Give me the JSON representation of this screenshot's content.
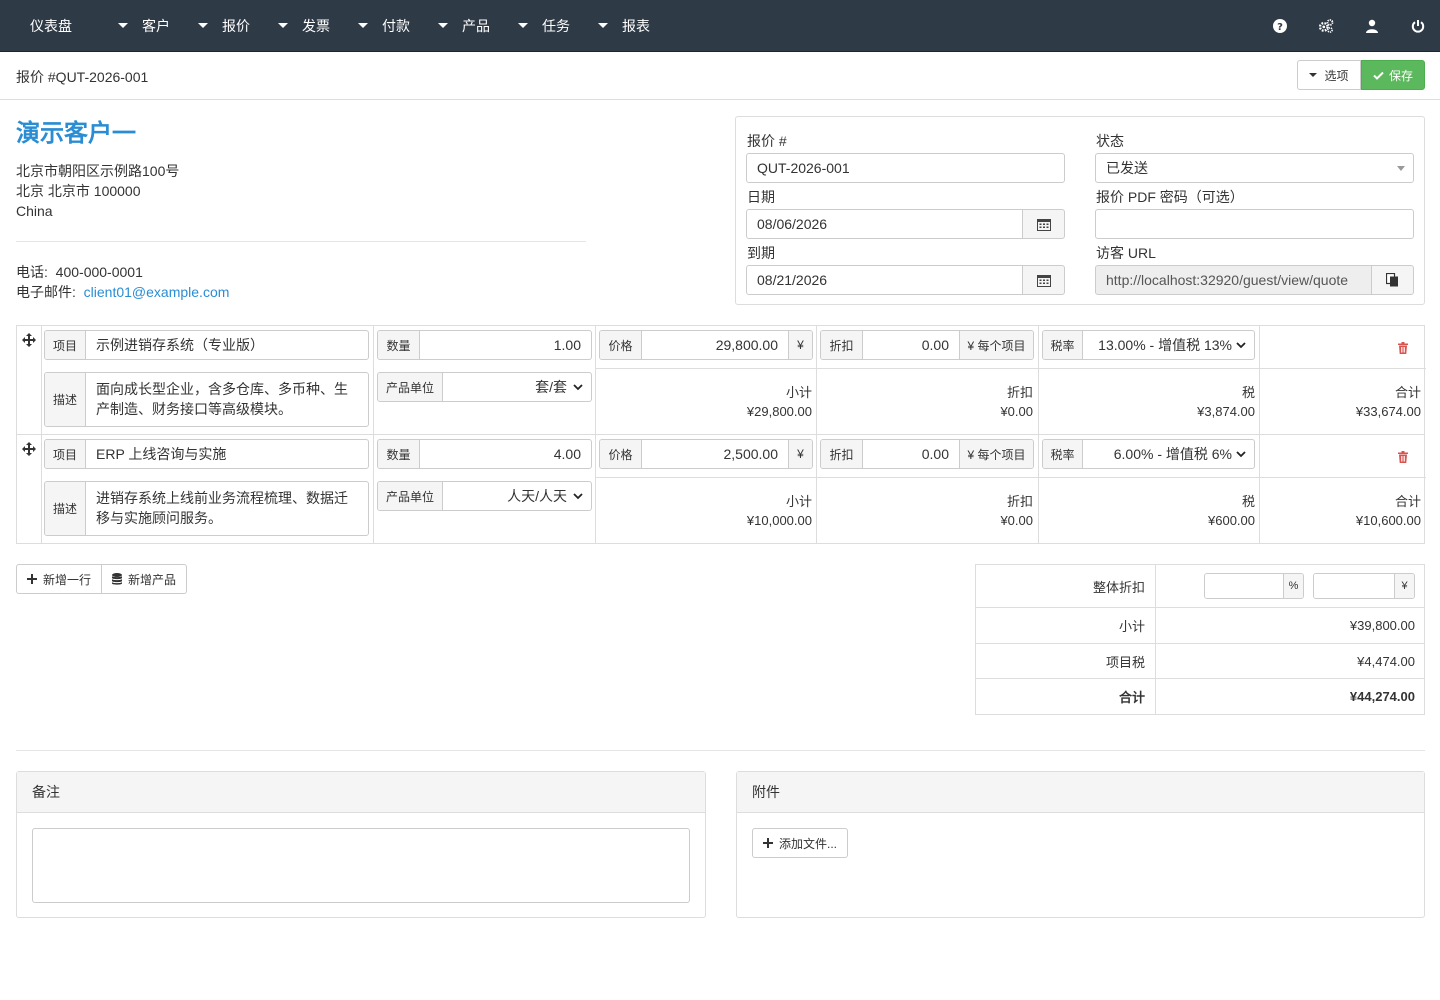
{
  "nav": {
    "items": [
      {
        "label": "仪表盘"
      },
      {
        "label": "客户"
      },
      {
        "label": "报价"
      },
      {
        "label": "发票"
      },
      {
        "label": "付款"
      },
      {
        "label": "产品"
      },
      {
        "label": "任务"
      },
      {
        "label": "报表"
      }
    ],
    "right_icons": [
      "question-icon",
      "gears-icon",
      "user-icon",
      "power-icon"
    ]
  },
  "header": {
    "title": "报价 #QUT-2026-001",
    "options_label": "选项",
    "save_label": "保存"
  },
  "client": {
    "name": "演示客户一",
    "address_line1": "北京市朝阳区示例路100号",
    "address_line2": "北京 北京市 100000",
    "country": "China",
    "phone_label": "电话:",
    "phone": "400-000-0001",
    "email_label": "电子邮件:",
    "email": "client01@example.com"
  },
  "quote": {
    "number_label": "报价 #",
    "number": "QUT-2026-001",
    "date_label": "日期",
    "date": "08/06/2026",
    "due_label": "到期",
    "due": "08/21/2026",
    "status_label": "状态",
    "status": "已发送",
    "pdf_password_label": "报价 PDF 密码（可选）",
    "pdf_password": "",
    "guest_url_label": "访客 URL",
    "guest_url": "http://localhost:32920/guest/view/quote"
  },
  "item_labels": {
    "item": "项目",
    "desc": "描述",
    "qty": "数量",
    "unit": "产品单位",
    "price": "价格",
    "currency": "¥",
    "discount": "折扣",
    "per_item": "¥ 每个项目",
    "tax_rate": "税率",
    "subtotal": "小计",
    "discount_total": "折扣",
    "tax": "税",
    "total": "合计"
  },
  "items": [
    {
      "name": "示例进销存系统（专业版）",
      "description": "面向成长型企业，含多仓库、多币种、生产制造、财务接口等高级模块。",
      "quantity": "1.00",
      "unit": "套/套",
      "price": "29,800.00",
      "discount": "0.00",
      "tax_rate": "13.00% - 增值税 13%",
      "subtotal": "¥29,800.00",
      "discount_amount": "¥0.00",
      "tax": "¥3,874.00",
      "total": "¥33,674.00"
    },
    {
      "name": "ERP 上线咨询与实施",
      "description": "进销存系统上线前业务流程梳理、数据迁移与实施顾问服务。",
      "quantity": "4.00",
      "unit": "人天/人天",
      "price": "2,500.00",
      "discount": "0.00",
      "tax_rate": "6.00% - 增值税 6%",
      "subtotal": "¥10,000.00",
      "discount_amount": "¥0.00",
      "tax": "¥600.00",
      "total": "¥10,600.00"
    }
  ],
  "actions": {
    "add_row": "新增一行",
    "add_product": "新增产品"
  },
  "totals": {
    "overall_discount_label": "整体折扣",
    "percent_unit": "%",
    "amount_unit": "¥",
    "subtotal_label": "小计",
    "subtotal": "¥39,800.00",
    "item_tax_label": "项目税",
    "item_tax": "¥4,474.00",
    "total_label": "合计",
    "total": "¥44,274.00"
  },
  "notes": {
    "title": "备注",
    "value": ""
  },
  "attachments": {
    "title": "附件",
    "add_file": "添加文件..."
  },
  "colors": {
    "navbar": "#2f3a47",
    "accent": "#2a8dd4",
    "save": "#5cb85c",
    "delete": "#d9534f"
  }
}
